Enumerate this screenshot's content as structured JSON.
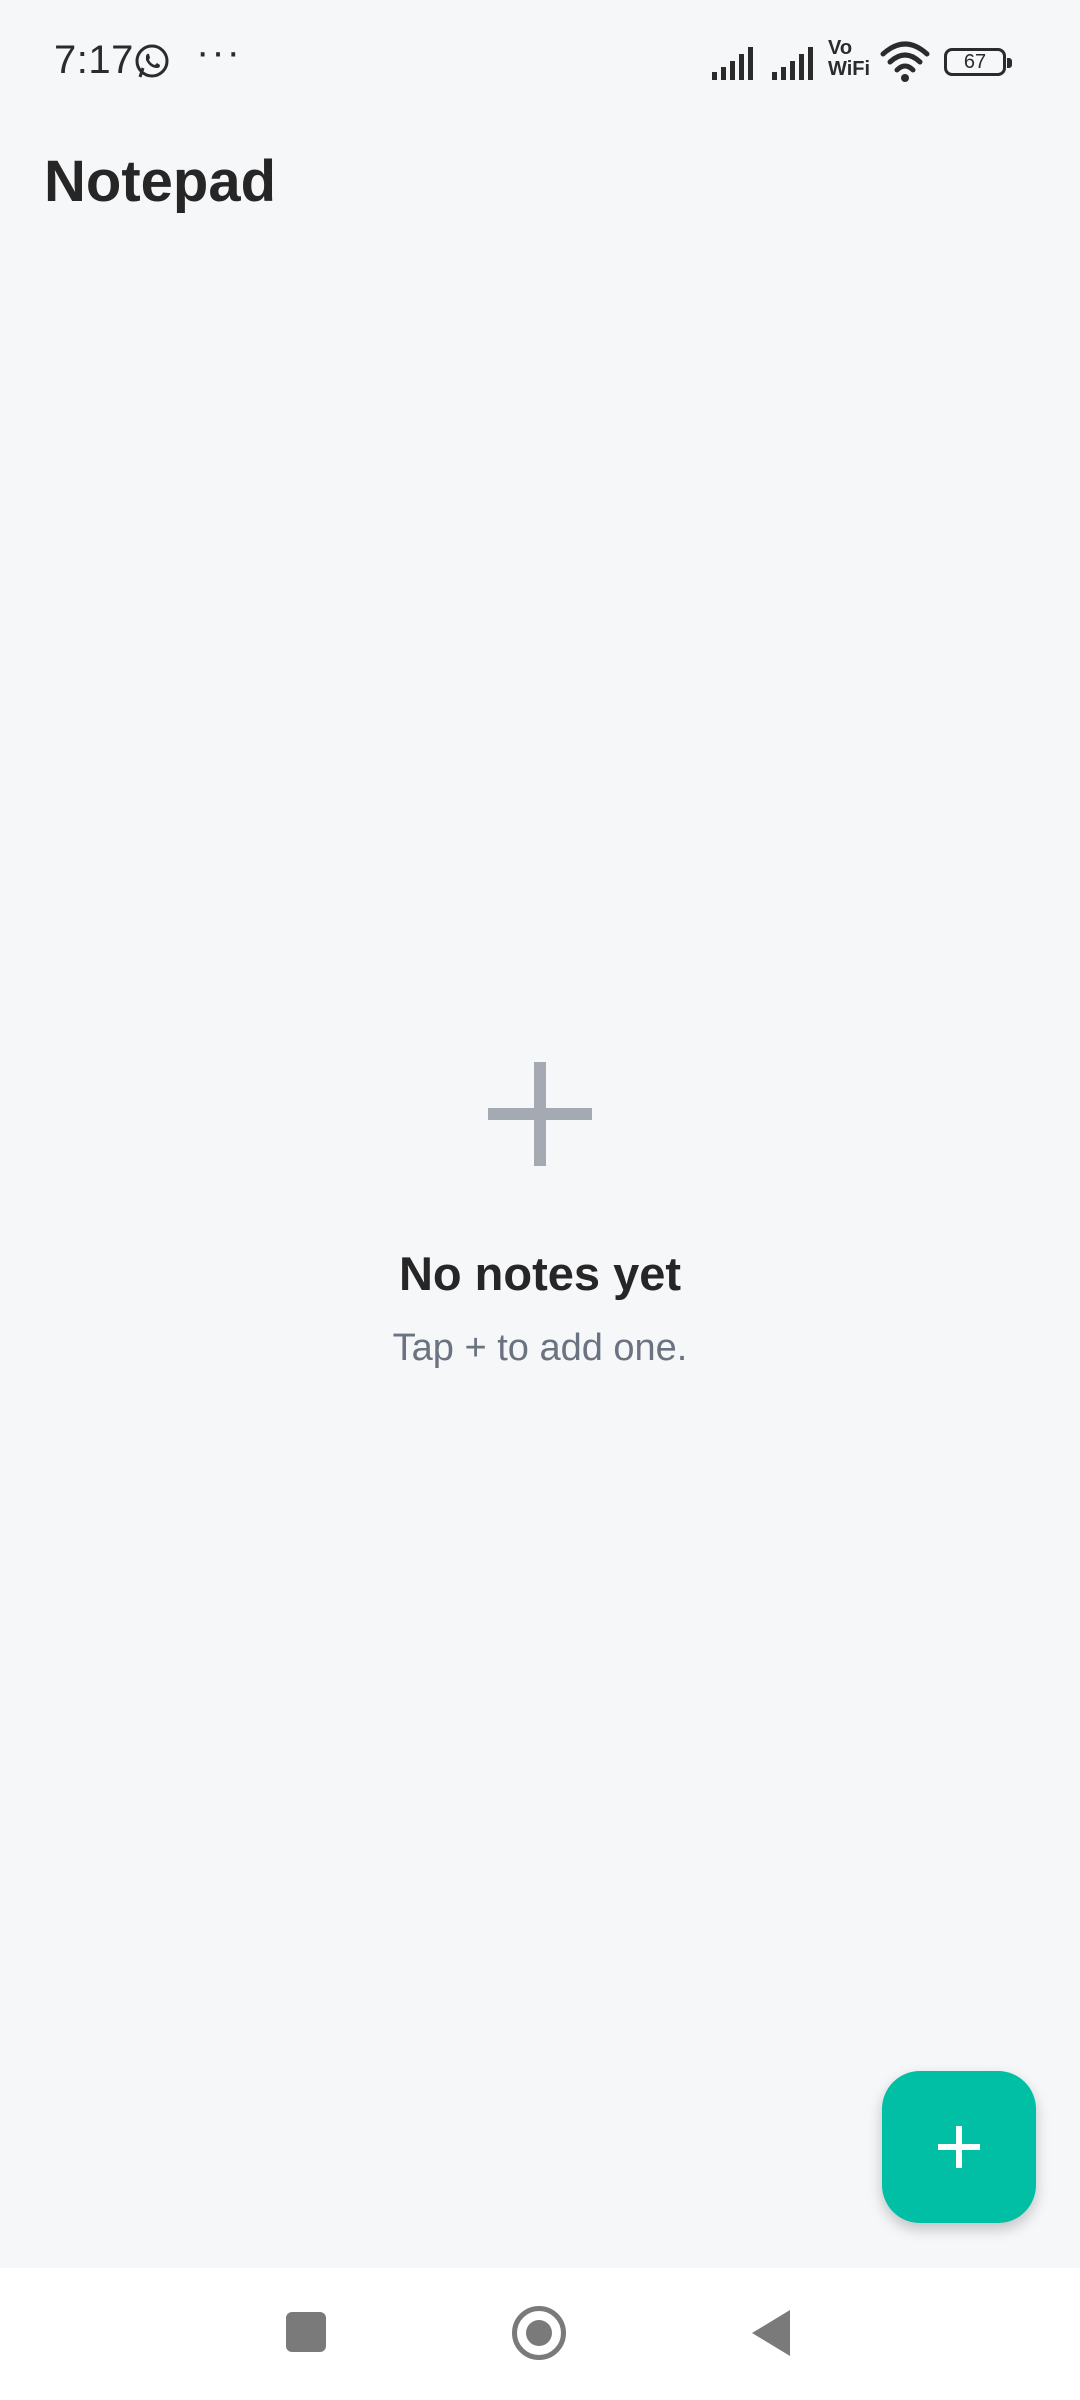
{
  "status_bar": {
    "time": "7:17",
    "more": "···",
    "vowifi_top": "Vo",
    "vowifi_bottom": "WiFi",
    "battery_level": "67",
    "icons": [
      "whatsapp-icon",
      "more-icon",
      "signal-icon",
      "signal-icon",
      "vowifi-icon",
      "wifi-icon",
      "battery-icon"
    ]
  },
  "header": {
    "title": "Notepad"
  },
  "empty_state": {
    "icon": "plus-icon",
    "title": "No notes yet",
    "subtitle": "Tap + to add one."
  },
  "fab": {
    "icon": "plus-icon",
    "color": "#00bfa5"
  },
  "nav_bar": {
    "icons": [
      "recents-icon",
      "home-icon",
      "back-icon"
    ]
  }
}
